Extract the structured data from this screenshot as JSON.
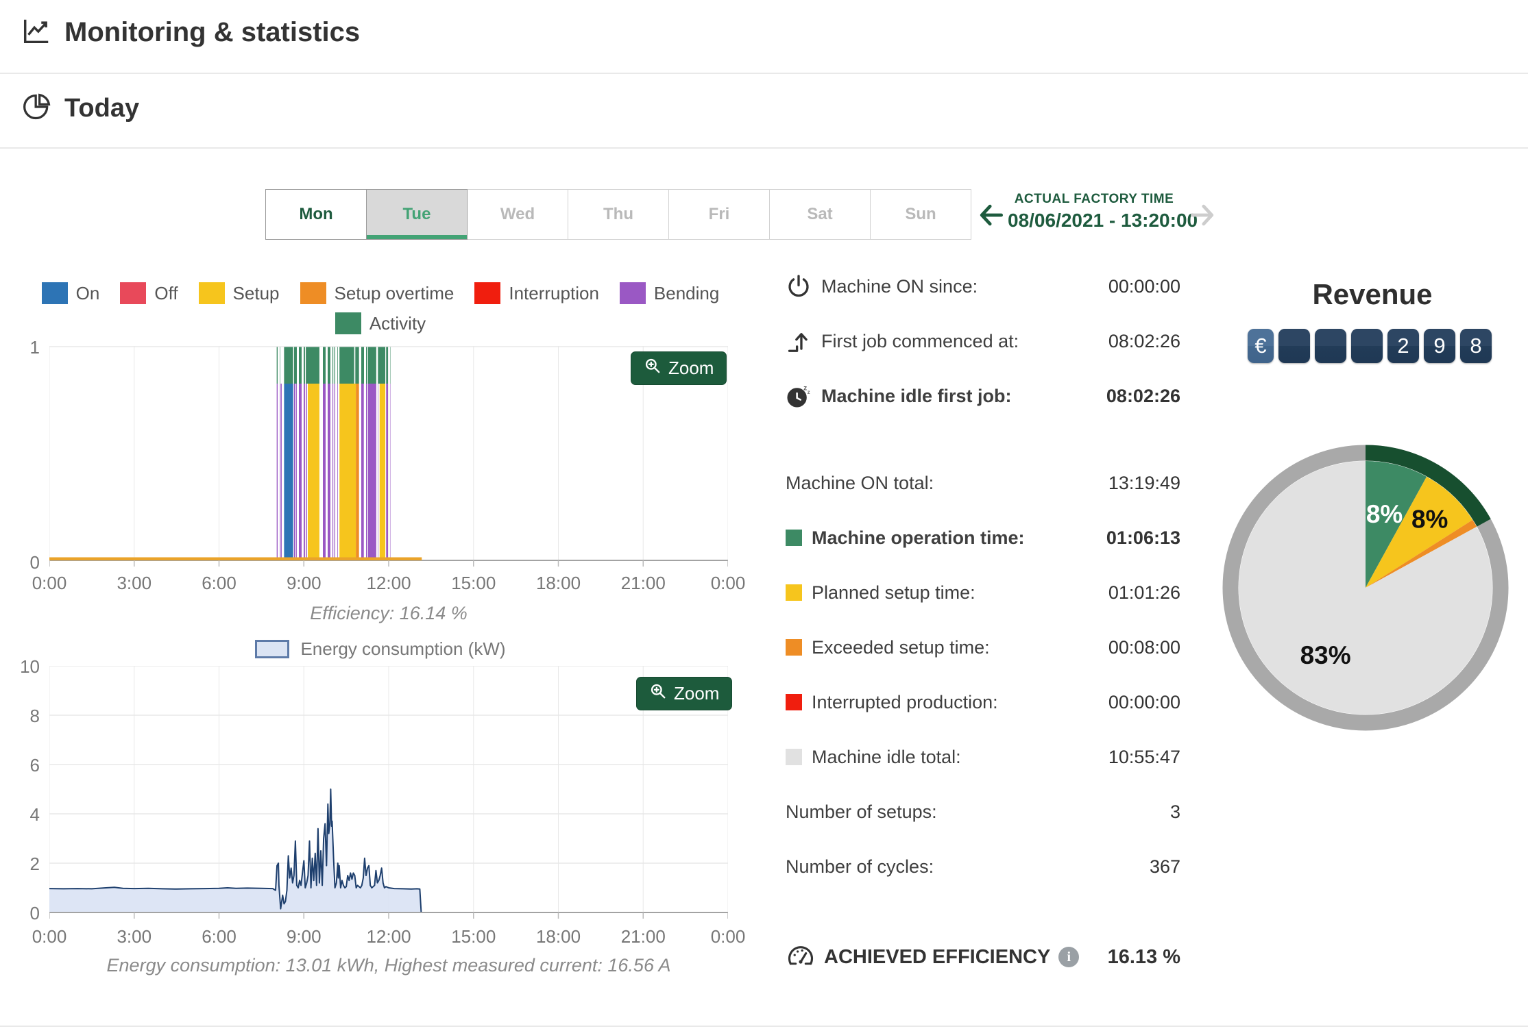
{
  "header": {
    "title": "Monitoring & statistics"
  },
  "section": {
    "title": "Today"
  },
  "day_tabs": [
    {
      "label": "Mon",
      "state": "past"
    },
    {
      "label": "Tue",
      "state": "selected"
    },
    {
      "label": "Wed",
      "state": "disabled"
    },
    {
      "label": "Thu",
      "state": "disabled"
    },
    {
      "label": "Fri",
      "state": "disabled"
    },
    {
      "label": "Sat",
      "state": "disabled"
    },
    {
      "label": "Sun",
      "state": "disabled"
    }
  ],
  "factory_time": {
    "label": "ACTUAL FACTORY TIME",
    "value": "08/06/2021 - 13:20:00"
  },
  "colors": {
    "on": "#2d74b5",
    "off": "#e8495a",
    "setup": "#f6c51d",
    "setup_overtime": "#ee8d25",
    "interruption": "#f01e0e",
    "bending": "#9a58c4",
    "activity": "#3d8a64",
    "idle": "#e1e1e1",
    "baseline": "#eaa32a",
    "ring_gray": "#a9a9a9",
    "ring_highlight": "#174f2f",
    "primary_green": "#1e5b3e",
    "energy_fill": "#dbe4f4",
    "energy_stroke": "#1e3f6d"
  },
  "legend_rows": [
    [
      {
        "label": "On",
        "color": "on"
      },
      {
        "label": "Off",
        "color": "off"
      },
      {
        "label": "Setup",
        "color": "setup"
      },
      {
        "label": "Setup overtime",
        "color": "setup_overtime"
      },
      {
        "label": "Interruption",
        "color": "interruption"
      },
      {
        "label": "Bending",
        "color": "bending"
      }
    ],
    [
      {
        "label": "Activity",
        "color": "activity"
      }
    ]
  ],
  "chart_data": [
    {
      "type": "timeline-bar",
      "title": "Machine state timeline",
      "zoom_label": "Zoom",
      "caption": "Efficiency: 16.14 %",
      "x_ticks": [
        "0:00",
        "3:00",
        "6:00",
        "9:00",
        "12:00",
        "15:00",
        "18:00",
        "21:00",
        "0:00"
      ],
      "y_ticks": [
        "1",
        "0"
      ],
      "x_range_hours": [
        0,
        24
      ],
      "baseline": {
        "s": 0,
        "e": 13.17,
        "color": "baseline"
      },
      "activity_band": [
        {
          "s": 8.04,
          "e": 8.16,
          "st": true
        },
        {
          "s": 8.3,
          "e": 8.62
        },
        {
          "s": 8.65,
          "e": 9.04,
          "st": true
        },
        {
          "s": 9.07,
          "e": 9.55
        },
        {
          "s": 9.6,
          "e": 10.04,
          "st": true
        },
        {
          "s": 10.08,
          "e": 10.2,
          "st": true
        },
        {
          "s": 10.26,
          "e": 10.78
        },
        {
          "s": 10.82,
          "e": 10.95
        },
        {
          "s": 11.0,
          "e": 11.24,
          "st": true
        },
        {
          "s": 11.27,
          "e": 11.56
        },
        {
          "s": 11.62,
          "e": 11.88
        },
        {
          "s": 11.91,
          "e": 12.06,
          "st": true
        }
      ],
      "state_band": [
        {
          "s": 8.04,
          "e": 8.16,
          "c": "bending",
          "st": true
        },
        {
          "s": 8.18,
          "e": 8.21,
          "c": "bending"
        },
        {
          "s": 8.3,
          "e": 8.62,
          "c": "on"
        },
        {
          "s": 8.65,
          "e": 8.7,
          "c": "bending"
        },
        {
          "s": 8.73,
          "e": 9.04,
          "c": "bending",
          "st": true
        },
        {
          "s": 9.07,
          "e": 9.1,
          "c": "bending"
        },
        {
          "s": 9.14,
          "e": 9.55,
          "c": "setup"
        },
        {
          "s": 9.6,
          "e": 10.04,
          "c": "bending",
          "st": true
        },
        {
          "s": 10.08,
          "e": 10.2,
          "c": "bending",
          "st": true
        },
        {
          "s": 10.26,
          "e": 10.84,
          "c": "setup"
        },
        {
          "s": 10.84,
          "e": 10.95,
          "c": "setup_overtime"
        },
        {
          "s": 11.0,
          "e": 11.12,
          "c": "bending",
          "st": true
        },
        {
          "s": 11.15,
          "e": 11.24,
          "c": "bending",
          "st": true
        },
        {
          "s": 11.27,
          "e": 11.56,
          "c": "bending"
        },
        {
          "s": 11.62,
          "e": 11.66,
          "c": "bending",
          "st": true
        },
        {
          "s": 11.68,
          "e": 11.88,
          "c": "setup"
        },
        {
          "s": 11.91,
          "e": 12.06,
          "c": "bending",
          "st": true
        }
      ]
    },
    {
      "type": "area",
      "legend_label": "Energy consumption (kW)",
      "zoom_label": "Zoom",
      "caption": "Energy consumption: 13.01 kWh, Highest measured current: 16.56 A",
      "x_ticks": [
        "0:00",
        "3:00",
        "6:00",
        "9:00",
        "12:00",
        "15:00",
        "18:00",
        "21:00",
        "0:00"
      ],
      "y_ticks": [
        "10",
        "8",
        "6",
        "4",
        "2",
        "0"
      ],
      "ylim": [
        0,
        10
      ],
      "x_range_hours": [
        0,
        24
      ],
      "points": [
        [
          0,
          0.97
        ],
        [
          0.5,
          0.96
        ],
        [
          1,
          0.97
        ],
        [
          1.5,
          0.96
        ],
        [
          2,
          1.0
        ],
        [
          2.3,
          1.02
        ],
        [
          2.6,
          0.98
        ],
        [
          3,
          0.97
        ],
        [
          3.5,
          0.98
        ],
        [
          4,
          0.96
        ],
        [
          4.5,
          0.95
        ],
        [
          5,
          0.96
        ],
        [
          5.5,
          0.97
        ],
        [
          6,
          0.98
        ],
        [
          6.3,
          1.0
        ],
        [
          6.6,
          0.98
        ],
        [
          7,
          0.99
        ],
        [
          7.5,
          0.98
        ],
        [
          7.9,
          0.97
        ],
        [
          8.0,
          0.9
        ],
        [
          8.05,
          1.9
        ],
        [
          8.1,
          2.0
        ],
        [
          8.12,
          1.1
        ],
        [
          8.18,
          0.15
        ],
        [
          8.25,
          0.7
        ],
        [
          8.3,
          0.35
        ],
        [
          8.35,
          0.45
        ],
        [
          8.4,
          0.9
        ],
        [
          8.45,
          2.3
        ],
        [
          8.5,
          1.4
        ],
        [
          8.55,
          1.8
        ],
        [
          8.6,
          1.2
        ],
        [
          8.65,
          1.5
        ],
        [
          8.7,
          2.9
        ],
        [
          8.75,
          1.1
        ],
        [
          8.8,
          1.0
        ],
        [
          8.85,
          1.3
        ],
        [
          8.9,
          1.1
        ],
        [
          8.95,
          1.6
        ],
        [
          9.0,
          2.1
        ],
        [
          9.05,
          1.0
        ],
        [
          9.1,
          1.2
        ],
        [
          9.15,
          1.5
        ],
        [
          9.2,
          2.9
        ],
        [
          9.25,
          1.0
        ],
        [
          9.3,
          2.2
        ],
        [
          9.35,
          1.3
        ],
        [
          9.4,
          2.4
        ],
        [
          9.45,
          1.1
        ],
        [
          9.5,
          3.4
        ],
        [
          9.55,
          1.2
        ],
        [
          9.6,
          2.5
        ],
        [
          9.65,
          1.1
        ],
        [
          9.7,
          3.0
        ],
        [
          9.75,
          3.6
        ],
        [
          9.8,
          1.9
        ],
        [
          9.85,
          4.4
        ],
        [
          9.88,
          3.2
        ],
        [
          9.92,
          3.6
        ],
        [
          9.95,
          5.0
        ],
        [
          9.98,
          3.5
        ],
        [
          10.0,
          3.7
        ],
        [
          10.05,
          2.2
        ],
        [
          10.1,
          1.0
        ],
        [
          10.15,
          1.2
        ],
        [
          10.2,
          2.0
        ],
        [
          10.22,
          1.4
        ],
        [
          10.25,
          1.9
        ],
        [
          10.3,
          1.0
        ],
        [
          10.35,
          1.3
        ],
        [
          10.4,
          1.1
        ],
        [
          10.45,
          1.0
        ],
        [
          10.5,
          1.05
        ],
        [
          10.55,
          1.5
        ],
        [
          10.6,
          1.3
        ],
        [
          10.65,
          1.6
        ],
        [
          10.7,
          1.35
        ],
        [
          10.75,
          1.6
        ],
        [
          10.8,
          1.5
        ],
        [
          10.85,
          1.0
        ],
        [
          10.9,
          1.1
        ],
        [
          10.95,
          1.05
        ],
        [
          11.0,
          1.0
        ],
        [
          11.05,
          1.1
        ],
        [
          11.1,
          1.4
        ],
        [
          11.15,
          2.2
        ],
        [
          11.2,
          1.5
        ],
        [
          11.25,
          1.8
        ],
        [
          11.3,
          1.9
        ],
        [
          11.35,
          1.1
        ],
        [
          11.4,
          1.0
        ],
        [
          11.45,
          1.05
        ],
        [
          11.5,
          1.1
        ],
        [
          11.55,
          1.7
        ],
        [
          11.6,
          1.2
        ],
        [
          11.65,
          1.3
        ],
        [
          11.7,
          1.5
        ],
        [
          11.75,
          1.8
        ],
        [
          11.8,
          1.2
        ],
        [
          11.85,
          1.0
        ],
        [
          11.9,
          1.05
        ],
        [
          12.0,
          1.0
        ],
        [
          12.2,
          0.97
        ],
        [
          12.5,
          0.96
        ],
        [
          12.8,
          0.95
        ],
        [
          13.0,
          0.96
        ],
        [
          13.1,
          0.95
        ],
        [
          13.15,
          0.02
        ]
      ]
    },
    {
      "type": "pie",
      "title": "Machine time distribution",
      "slices": [
        {
          "value": 8,
          "color": "activity",
          "label": "8%",
          "label_color": "#ffffff",
          "label_r": 0.6
        },
        {
          "value": 8,
          "color": "setup",
          "label": "8%",
          "label_color": "#111111",
          "label_r": 0.74
        },
        {
          "value": 1,
          "color": "setup_overtime"
        },
        {
          "value": 83,
          "color": "idle",
          "label": "83%",
          "label_color": "#111111",
          "label_r": 0.62
        }
      ],
      "ring": {
        "color": "ring_gray",
        "highlight_color": "ring_highlight",
        "highlight_deg": 61.2
      }
    }
  ],
  "stats": {
    "rows": [
      {
        "icon": "power",
        "label": "Machine ON since:",
        "value": "00:00:00"
      },
      {
        "icon": "job-start",
        "label": "First job commenced at:",
        "value": "08:02:26"
      },
      {
        "icon": "idle-clock",
        "label": "Machine idle first job:",
        "value": "08:02:26",
        "bold": true
      },
      {
        "gap_before": true,
        "label": "Machine ON total:",
        "value": "13:19:49"
      },
      {
        "swatch": "activity",
        "label": "Machine operation time:",
        "value": "01:06:13",
        "bold": true
      },
      {
        "swatch": "setup",
        "label": "Planned setup time:",
        "value": "01:01:26"
      },
      {
        "swatch": "setup_overtime",
        "label": "Exceeded setup time:",
        "value": "00:08:00"
      },
      {
        "swatch": "interruption",
        "label": "Interrupted production:",
        "value": "00:00:00"
      },
      {
        "swatch": "idle",
        "label": "Machine idle total:",
        "value": "10:55:47"
      },
      {
        "label": "Number of setups:",
        "value": "3"
      },
      {
        "label": "Number of cycles:",
        "value": "367"
      }
    ]
  },
  "efficiency": {
    "label": "ACHIEVED EFFICIENCY",
    "info_icon": "i",
    "value": "16.13 %"
  },
  "revenue": {
    "title": "Revenue",
    "currency": "€",
    "digits": [
      "",
      "",
      "",
      "2",
      "9",
      "8"
    ]
  }
}
